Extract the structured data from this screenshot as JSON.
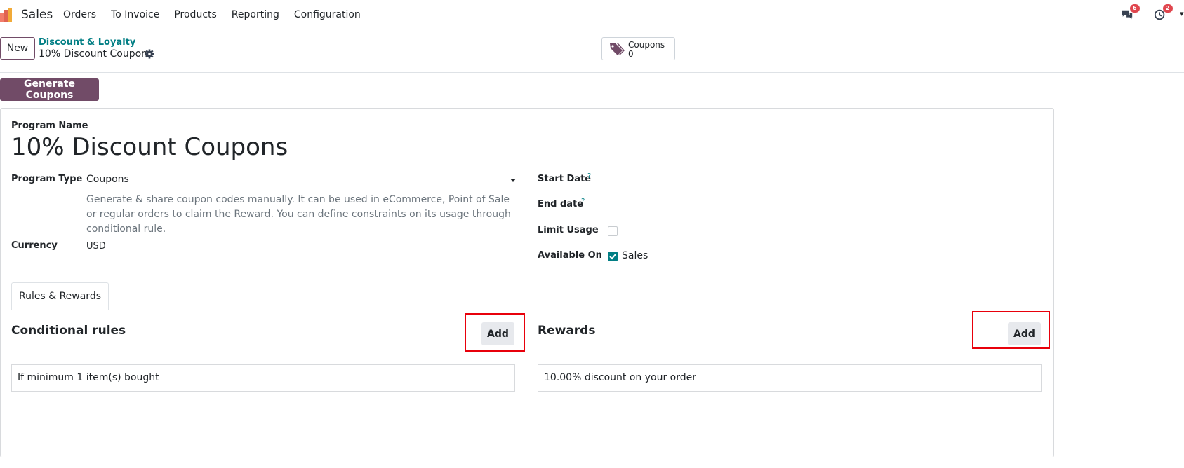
{
  "app": {
    "name": "Sales",
    "menu": [
      "Orders",
      "To Invoice",
      "Products",
      "Reporting",
      "Configuration"
    ],
    "messages_badge": "6",
    "activities_badge": "2"
  },
  "control": {
    "new_label": "New",
    "breadcrumb_parent": "Discount & Loyalty",
    "breadcrumb_current": "10% Discount Coupons",
    "smart_button": {
      "label": "Coupons",
      "count": "0"
    }
  },
  "action": {
    "generate_label": "Generate Coupons"
  },
  "form": {
    "program_name_label": "Program Name",
    "program_name": "10% Discount Coupons",
    "program_type_label": "Program Type",
    "program_type": "Coupons",
    "program_type_help": "Generate & share coupon codes manually. It can be used in eCommerce, Point of Sale or regular orders to claim the Reward. You can define constraints on its usage through conditional rule.",
    "currency_label": "Currency",
    "currency": "USD",
    "start_date_label": "Start Date",
    "end_date_label": "End date",
    "help_mark": "?",
    "limit_usage_label": "Limit Usage",
    "limit_usage_checked": false,
    "available_on_label": "Available On",
    "available_on_option": "Sales",
    "available_on_checked": true
  },
  "tabs": [
    {
      "label": "Rules & Rewards",
      "active": true
    }
  ],
  "rules": {
    "title": "Conditional rules",
    "add_label": "Add",
    "items": [
      "If minimum 1 item(s) bought"
    ]
  },
  "rewards": {
    "title": "Rewards",
    "add_label": "Add",
    "items": [
      "10.00% discount on your order"
    ]
  },
  "colors": {
    "brand": "#714b67",
    "accent": "#017e84",
    "highlight": "#e8000b",
    "badge": "#e0464e"
  }
}
